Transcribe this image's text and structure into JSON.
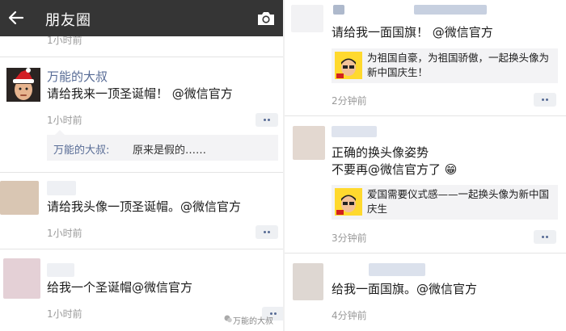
{
  "header": {
    "title": "朋友圈"
  },
  "left": {
    "top_time": "1小时前",
    "posts": [
      {
        "name": "万能的大叔",
        "text": "请给我来一顶圣诞帽！ @微信官方",
        "time": "1小时前",
        "comment": {
          "author": "万能的大叔:",
          "text": "原来是假的……"
        }
      },
      {
        "name": "",
        "text": "请给我头像一顶圣诞帽。@微信官方",
        "time": "1小时前"
      },
      {
        "name": "",
        "text": "给我一个圣诞帽@微信官方",
        "time": "1小时前"
      }
    ]
  },
  "right": {
    "posts": [
      {
        "text": "请给我一面国旗！ @微信官方",
        "time": "2分钟前",
        "link": "为祖国自豪，为祖国骄傲，一起换头像为新中国庆生！"
      },
      {
        "text_line1": "正确的换头像姿势",
        "text_line2": "不要再@微信官方了",
        "emoji": "😁",
        "time": "3分钟前",
        "link": "爱国需要仪式感——一起换头像为新中国庆生"
      },
      {
        "text": "给我一面国旗。@微信官方",
        "time": "4分钟前"
      }
    ]
  },
  "watermark": "万能的大叔",
  "icons": [
    "back-arrow-icon",
    "camera-icon",
    "more-icon",
    "emoji-grin-icon",
    "watermark-logo-icon"
  ]
}
